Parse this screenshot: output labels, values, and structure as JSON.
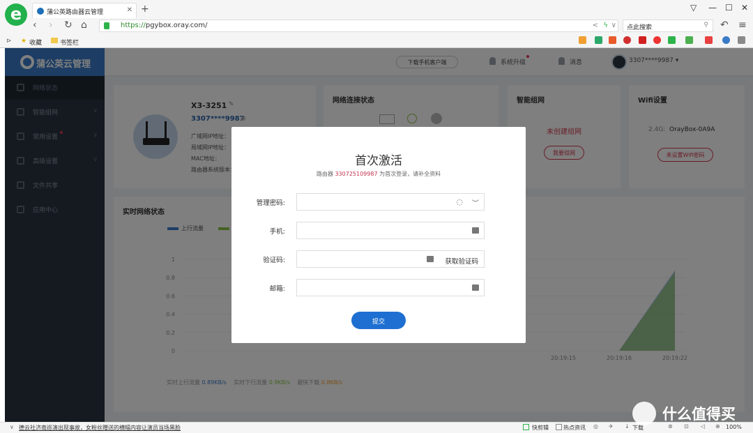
{
  "browser": {
    "tab_title": "蒲公英路由器云管理",
    "url_scheme": "https://",
    "url_host": "pgybox.oray.com/",
    "search_placeholder": "点此搜索",
    "bookmarks": [
      "收藏",
      "书签栏"
    ]
  },
  "app": {
    "brand": "蒲公英云管理",
    "sidebar": [
      {
        "label": "网络状态",
        "active": true
      },
      {
        "label": "智能组网"
      },
      {
        "label": "常用设置"
      },
      {
        "label": "高级设置"
      },
      {
        "label": "文件共享"
      },
      {
        "label": "应用中心"
      }
    ],
    "topbar": {
      "download_client": "下载手机客户端",
      "system_upgrade": "系统升级",
      "messages": "消息",
      "account": "3307****9987"
    },
    "device": {
      "name": "X3-3251",
      "account": "3307****9987",
      "wan_ip_label": "广域网IP地址：",
      "lan_ip_label": "局域网IP地址：",
      "mac_label": "MAC地址：",
      "firmware_label": "路由器系统版本："
    },
    "cards": {
      "network_status": "网络连接状态",
      "smart_network": "智能组网",
      "not_created": "未创建组网",
      "create_network": "我要组网",
      "wifi_title": "Wifi设置",
      "wifi_band": "2.4G:",
      "wifi_ssid": "OrayBox-0A9A",
      "wifi_not_set": "未设置Wifi密码"
    },
    "realtime": {
      "title": "实时网络状态",
      "legend_up": "上行流量",
      "colors": {
        "up": "#3a7bc8",
        "down": "#8bc34a"
      },
      "footer_up_label": "实时上行流量",
      "footer_up_value": "0.89KB/s",
      "footer_down_label": "实时下行流量",
      "footer_down_value": "0.9KB/s",
      "footer_max_label": "最快下载",
      "footer_max_value": "0.8KB/s"
    }
  },
  "chart_data": {
    "type": "area",
    "x": [
      "20:19:15",
      "20:19:16",
      "20:19:22"
    ],
    "series": [
      {
        "name": "上行流量",
        "values": [
          0,
          0,
          0.88
        ]
      },
      {
        "values": [
          0,
          0,
          0.86
        ]
      }
    ],
    "ylim": [
      0,
      1
    ],
    "yticks": [
      "1",
      "0.8",
      "0.6",
      "0.4",
      "0.2",
      "0"
    ]
  },
  "modal": {
    "title": "首次激活",
    "subtitle_prefix": "路由器",
    "serial": "330725109987",
    "subtitle_suffix": "为首次登录，请补全资料",
    "password_label": "管理密码:",
    "phone_label": "手机:",
    "code_label": "验证码:",
    "get_code": "获取验证码",
    "email_label": "邮箱:",
    "submit": "提交"
  },
  "statusbar": {
    "news": "德云社济南巡演出现事故，女粉丝赠送的横幅内容让演员当场黑脸",
    "quick_clip": "快剪辑",
    "hot_news": "热点资讯",
    "download": "下载",
    "zoom": "100%"
  },
  "watermark": "什么值得买"
}
